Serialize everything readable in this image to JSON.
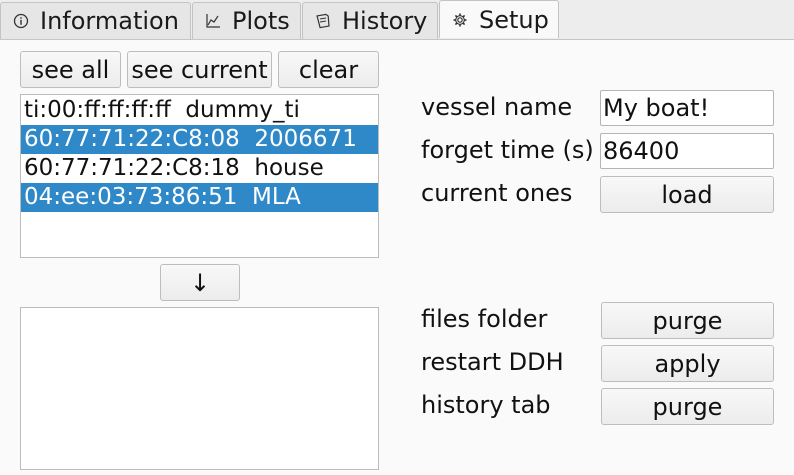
{
  "tabs": [
    {
      "label": "Information",
      "icon": "info-icon"
    },
    {
      "label": "Plots",
      "icon": "chart-icon"
    },
    {
      "label": "History",
      "icon": "history-icon"
    },
    {
      "label": "Setup",
      "icon": "gear-icon",
      "active": true
    }
  ],
  "toolbar": {
    "see_all_label": "see all",
    "see_current_label": "see current",
    "clear_label": "clear"
  },
  "devices": [
    {
      "text": "ti:00:ff:ff:ff:ff  dummy_ti",
      "selected": false
    },
    {
      "text": "60:77:71:22:C8:08  2006671",
      "selected": true
    },
    {
      "text": "60:77:71:22:C8:18  house",
      "selected": false
    },
    {
      "text": "04:ee:03:73:86:51  MLA",
      "selected": true
    }
  ],
  "move_down_label": "↓",
  "settings": {
    "vessel_name_label": "vessel name",
    "vessel_name_value": "My boat!",
    "forget_time_label": "forget time (s)",
    "forget_time_value": "86400",
    "current_ones_label": "current ones",
    "load_label": "load"
  },
  "maintenance": {
    "files_folder_label": "files folder",
    "files_purge_label": "purge",
    "restart_label": "restart DDH",
    "apply_label": "apply",
    "history_tab_label": "history tab",
    "history_purge_label": "purge"
  },
  "colors": {
    "selection": "#2f88c8",
    "background": "#fafafa"
  }
}
